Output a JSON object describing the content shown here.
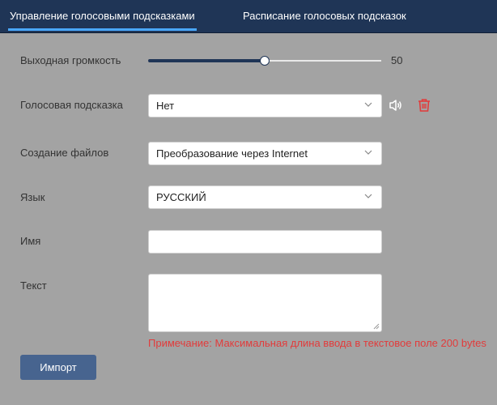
{
  "tabs": [
    {
      "label": "Управление голосовыми подсказками",
      "active": true
    },
    {
      "label": "Расписание голосовых подсказок",
      "active": false
    }
  ],
  "form": {
    "volume": {
      "label": "Выходная громкость",
      "value": 50,
      "value_text": "50",
      "max": 100
    },
    "voice_prompt": {
      "label": "Голосовая подсказка",
      "selected": "Нет",
      "play_icon": "speaker-icon",
      "delete_icon": "trash-icon"
    },
    "file_creation": {
      "label": "Создание файлов",
      "selected": "Преобразование через Internet"
    },
    "language": {
      "label": "Язык",
      "selected": "РУССКИЙ"
    },
    "name": {
      "label": "Имя",
      "value": ""
    },
    "text": {
      "label": "Текст",
      "value": ""
    },
    "note": "Примечание: Максимальная длина ввода в текстовое поле 200 bytes"
  },
  "import_button": "Импорт",
  "colors": {
    "header": "#1f3556",
    "accent": "#4aa8ff",
    "danger": "#e23b3b",
    "button": "#47648f",
    "background": "#a3a3a3"
  }
}
